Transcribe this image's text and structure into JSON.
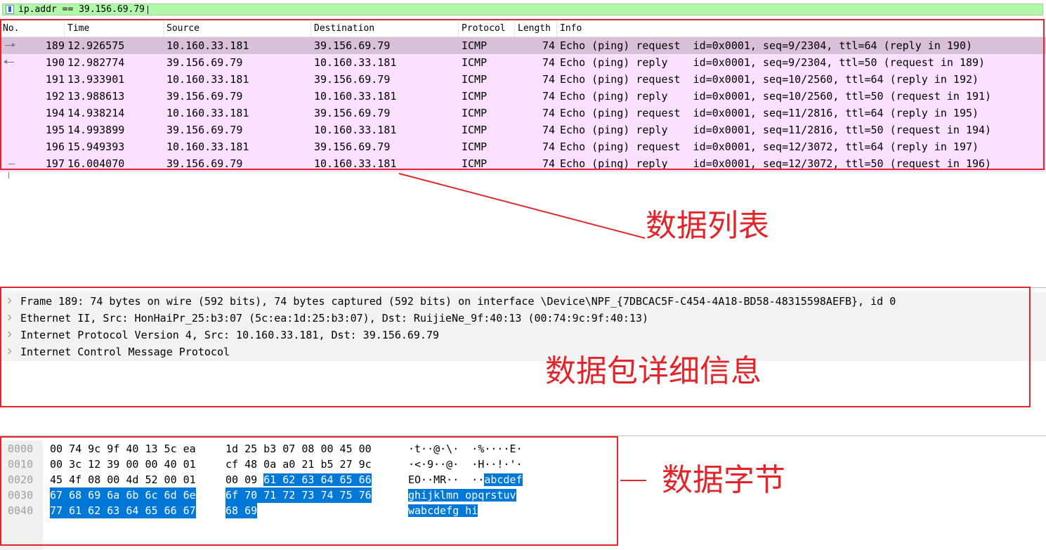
{
  "filter": {
    "value": "ip.addr == 39.156.69.79"
  },
  "packet_list": {
    "columns": [
      "No.",
      "Time",
      "Source",
      "Destination",
      "Protocol",
      "Length",
      "Info"
    ],
    "rows": [
      {
        "no": "189",
        "time": "12.926575",
        "src": "10.160.33.181",
        "dst": "39.156.69.79",
        "proto": "ICMP",
        "len": "74",
        "info": "Echo (ping) request  id=0x0001, seq=9/2304, ttl=64 (reply in 190)"
      },
      {
        "no": "190",
        "time": "12.982774",
        "src": "39.156.69.79",
        "dst": "10.160.33.181",
        "proto": "ICMP",
        "len": "74",
        "info": "Echo (ping) reply    id=0x0001, seq=9/2304, ttl=50 (request in 189)"
      },
      {
        "no": "191",
        "time": "13.933901",
        "src": "10.160.33.181",
        "dst": "39.156.69.79",
        "proto": "ICMP",
        "len": "74",
        "info": "Echo (ping) request  id=0x0001, seq=10/2560, ttl=64 (reply in 192)"
      },
      {
        "no": "192",
        "time": "13.988613",
        "src": "39.156.69.79",
        "dst": "10.160.33.181",
        "proto": "ICMP",
        "len": "74",
        "info": "Echo (ping) reply    id=0x0001, seq=10/2560, ttl=50 (request in 191)"
      },
      {
        "no": "194",
        "time": "14.938214",
        "src": "10.160.33.181",
        "dst": "39.156.69.79",
        "proto": "ICMP",
        "len": "74",
        "info": "Echo (ping) request  id=0x0001, seq=11/2816, ttl=64 (reply in 195)"
      },
      {
        "no": "195",
        "time": "14.993899",
        "src": "39.156.69.79",
        "dst": "10.160.33.181",
        "proto": "ICMP",
        "len": "74",
        "info": "Echo (ping) reply    id=0x0001, seq=11/2816, ttl=50 (request in 194)"
      },
      {
        "no": "196",
        "time": "15.949393",
        "src": "10.160.33.181",
        "dst": "39.156.69.79",
        "proto": "ICMP",
        "len": "74",
        "info": "Echo (ping) request  id=0x0001, seq=12/3072, ttl=64 (reply in 197)"
      },
      {
        "no": "197",
        "time": "16.004070",
        "src": "39.156.69.79",
        "dst": "10.160.33.181",
        "proto": "ICMP",
        "len": "74",
        "info": "Echo (ping) reply    id=0x0001, seq=12/3072, ttl=50 (request in 196)"
      }
    ]
  },
  "details": [
    "Frame 189: 74 bytes on wire (592 bits), 74 bytes captured (592 bits) on interface \\Device\\NPF_{7DBCAC5F-C454-4A18-BD58-48315598AEFB}, id 0",
    "Ethernet II, Src: HonHaiPr_25:b3:07 (5c:ea:1d:25:b3:07), Dst: RuijieNe_9f:40:13 (00:74:9c:9f:40:13)",
    "Internet Protocol Version 4, Src: 10.160.33.181, Dst: 39.156.69.79",
    "Internet Control Message Protocol"
  ],
  "bytes": [
    {
      "offset": "0000",
      "hex1": "00 74 9c 9f 40 13 5c ea",
      "hex2": "1d 25 b3 07 08 00 45 00",
      "ascii": "·t··@·\\·  ·%····E·"
    },
    {
      "offset": "0010",
      "hex1": "00 3c 12 39 00 00 40 01",
      "hex2": "cf 48 0a a0 21 b5 27 9c",
      "ascii": "·<·9··@·  ·H··!·'·"
    },
    {
      "offset": "0020",
      "hex1": "45 4f 08 00 4d 52 00 01",
      "hex2_plain": "00 09 ",
      "hex2_hl": "61 62 63 64 65 66",
      "ascii_plain": "EO··MR··  ··",
      "ascii_hl": "abcdef"
    },
    {
      "offset": "0030",
      "hex1_hl": "67 68 69 6a 6b 6c 6d 6e",
      "hex2_hl": "6f 70 71 72 73 74 75 76",
      "ascii_hl1": "ghijklmn",
      "ascii_hl2": "opqrstuv"
    },
    {
      "offset": "0040",
      "hex1_hl": "77 61 62 63 64 65 66 67",
      "hex2_hl": "68 69",
      "ascii_hl1": "wabcdefg",
      "ascii_hl2": "hi"
    }
  ],
  "annotations": {
    "list": "数据列表",
    "details": "数据包详细信息",
    "bytes": "数据字节",
    "accent": "#e0262a"
  }
}
